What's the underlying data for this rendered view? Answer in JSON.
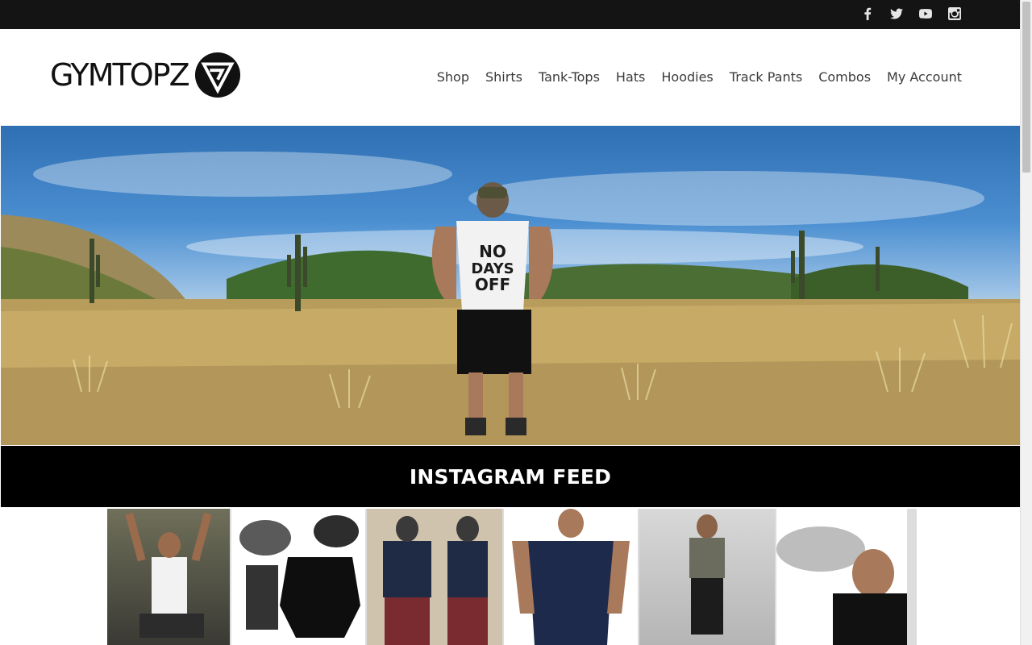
{
  "social": {
    "icons": [
      "facebook-icon",
      "twitter-icon",
      "youtube-icon",
      "instagram-icon"
    ]
  },
  "brand": {
    "name": "GYMTOPZ"
  },
  "nav": {
    "items": [
      "Shop",
      "Shirts",
      "Tank-Tops",
      "Hats",
      "Hoodies",
      "Track Pants",
      "Combos",
      "My Account"
    ]
  },
  "hero": {
    "shirt_text": [
      "NO",
      "DAYS",
      "OFF"
    ]
  },
  "instagram": {
    "title": "INSTAGRAM FEED"
  },
  "colors": {
    "topbar": "#141414",
    "nav_text": "#3a3a3a",
    "instagram_bar": "#000000"
  }
}
